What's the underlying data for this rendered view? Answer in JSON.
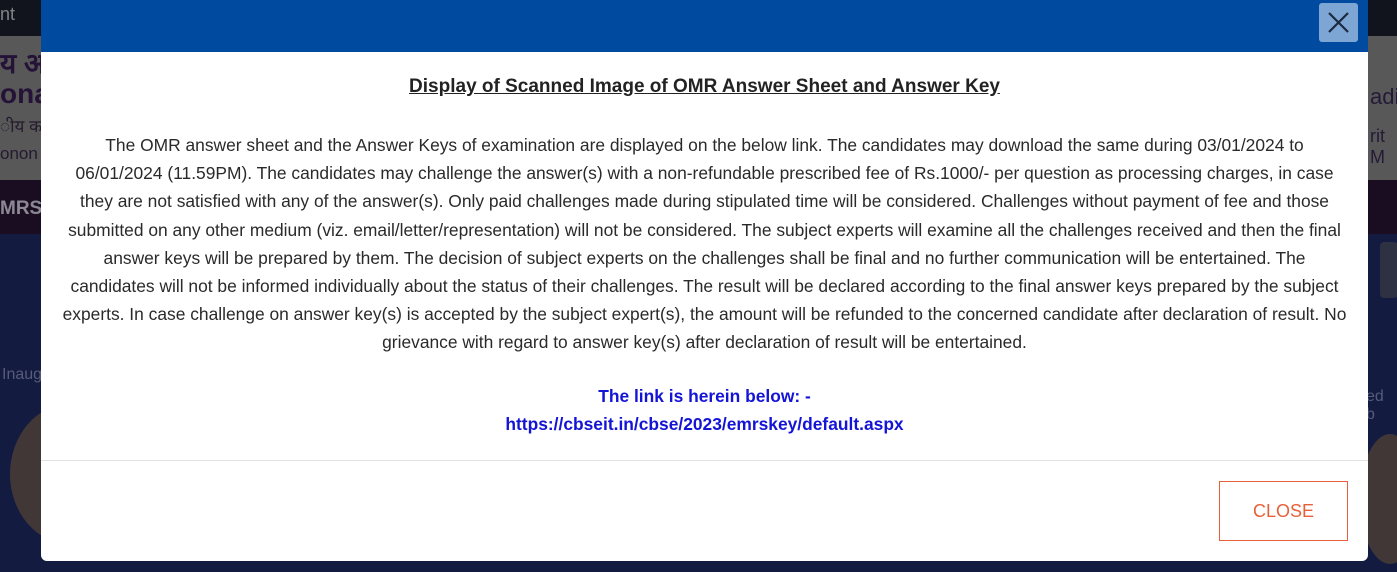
{
  "background": {
    "topbar_text": "nt",
    "header_line1": "य अ",
    "header_line2": "ona",
    "header_line3": "ीय का",
    "header_line4": "onon",
    "header_right1": "adi",
    "header_right2": "rit M",
    "nav_text": "MRS",
    "inaug_text": "Inaug",
    "byline_text": "ed b"
  },
  "modal": {
    "title": "Display of Scanned Image of OMR Answer Sheet and Answer Key",
    "paragraph": "The OMR answer sheet and the Answer Keys of examination are displayed on the below link. The candidates may download the same during 03/01/2024 to 06/01/2024 (11.59PM). The candidates may challenge the answer(s) with a non-refundable prescribed fee of Rs.1000/- per question as processing charges, in case they are not satisfied with any of the answer(s). Only paid challenges made during stipulated time will be considered. Challenges without payment of fee and those submitted on any other medium (viz. email/letter/representation) will not be considered. The subject experts will examine all the challenges received and then the final answer keys will be prepared by them. The decision of subject experts on the challenges shall be final and no further communication will be entertained. The candidates will not be informed individually about the status of their challenges. The result will be declared according to the final answer keys prepared by the subject experts. In case challenge on answer key(s) is accepted by the subject expert(s), the amount will be refunded to the concerned candidate after declaration of result. No grievance with regard to answer key(s) after declaration of result will be entertained.",
    "link_label": "The link is herein below: -",
    "link_url": "https://cbseit.in/cbse/2023/emrskey/default.aspx",
    "close_button": "CLOSE",
    "close_icon": "close-icon"
  },
  "colors": {
    "header_blue": "#004aa0",
    "link_blue": "#1414d6",
    "close_orange": "#e8603a"
  }
}
